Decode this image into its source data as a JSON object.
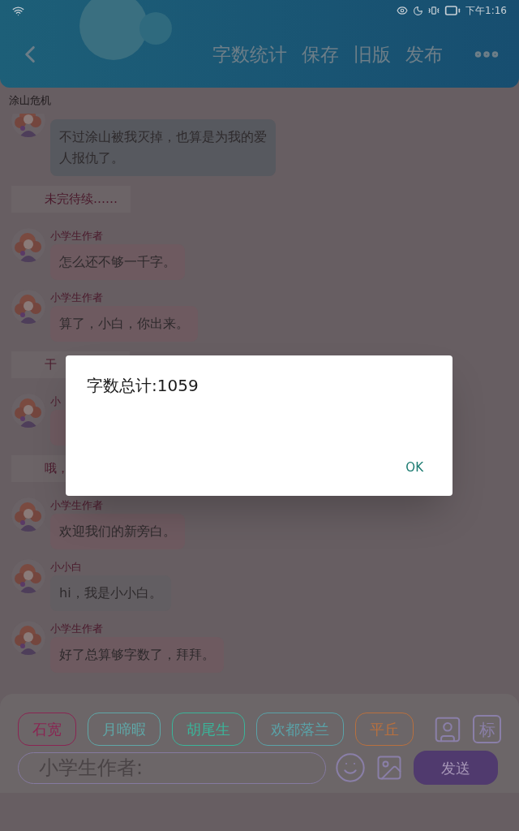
{
  "status_bar": {
    "time": "下午1:16"
  },
  "toolbar": {
    "actions": [
      "字数统计",
      "保存",
      "旧版",
      "发布"
    ]
  },
  "chat": {
    "title": "涂山危机",
    "items": [
      {
        "kind": "message",
        "text": "不过涂山被我灭掉，也算是为我的爱人报仇了。",
        "color": "#57595f"
      },
      {
        "kind": "narration",
        "text": "未完待续……"
      },
      {
        "kind": "message",
        "name": "小学生作者",
        "text": "怎么还不够一千字。",
        "color": "#6e5a60"
      },
      {
        "kind": "message",
        "name": "小学生作者",
        "text": "算了，小白，你出来。",
        "color": "#6e5a60"
      },
      {
        "kind": "narration",
        "text": "干"
      },
      {
        "kind": "message",
        "name": "小",
        "color": "#6e5a60"
      },
      {
        "kind": "narration",
        "text": "哦，"
      },
      {
        "kind": "message",
        "name": "小学生作者",
        "text": "欢迎我们的新旁白。",
        "color": "#6e5a60"
      },
      {
        "kind": "message",
        "name": "小小白",
        "text": "hi，我是小小白。",
        "color": "#625e62"
      },
      {
        "kind": "message",
        "name": "小学生作者",
        "text": "好了总算够字数了，拜拜。",
        "color": "#6e5a60"
      }
    ]
  },
  "composer": {
    "characters": [
      {
        "name": "石宽",
        "color": "#8a2452"
      },
      {
        "name": "月啼暇",
        "color": "#5fa8a8"
      },
      {
        "name": "胡尾生",
        "color": "#3ab59a"
      },
      {
        "name": "欢都落兰",
        "color": "#5aa2a8"
      },
      {
        "name": "平丘",
        "color": "#b8703f"
      }
    ],
    "tag_button": "标",
    "placeholder": "小学生作者:",
    "send": "发送"
  },
  "dialog": {
    "message": "字数总计:1059",
    "button": "OK"
  }
}
